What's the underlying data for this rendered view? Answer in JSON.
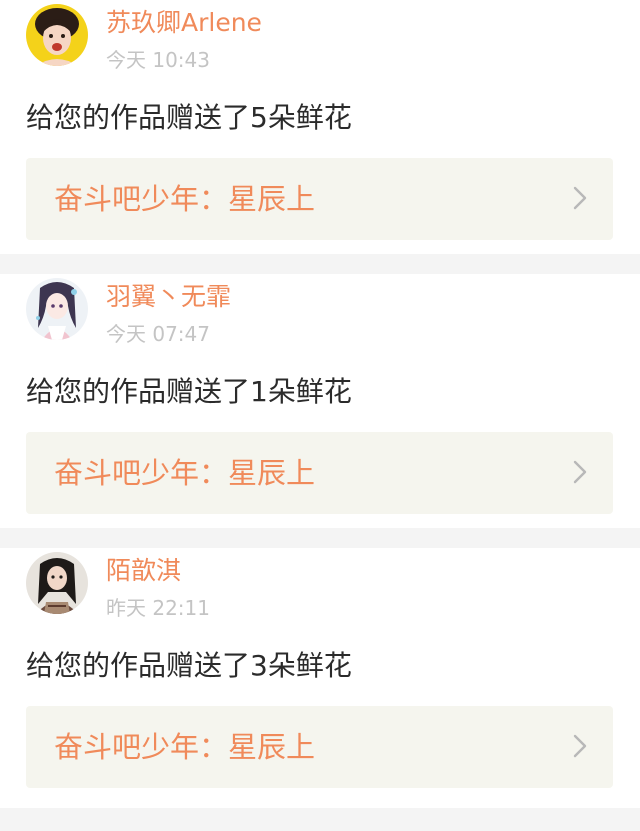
{
  "notifications": [
    {
      "username": "苏玖卿Arlene",
      "time": "今天 10:43",
      "message": "给您的作品赠送了5朵鲜花",
      "work_title": "奋斗吧少年：星辰上",
      "avatar_icon": "avatar-girl-yellow-icon"
    },
    {
      "username": "羽翼丶无霏",
      "time": "今天 07:47",
      "message": "给您的作品赠送了1朵鲜花",
      "work_title": "奋斗吧少年：星辰上",
      "avatar_icon": "avatar-anime-girl-icon"
    },
    {
      "username": "陌歆淇",
      "time": "昨天 22:11",
      "message": "给您的作品赠送了3朵鲜花",
      "work_title": "奋斗吧少年：星辰上",
      "avatar_icon": "avatar-girl-portrait-icon"
    }
  ],
  "colors": {
    "accent": "#f08a5a",
    "time": "#c4c4c4",
    "text": "#2b2b2b",
    "link_bg": "#f5f5ee",
    "separator": "#f4f4f4"
  }
}
